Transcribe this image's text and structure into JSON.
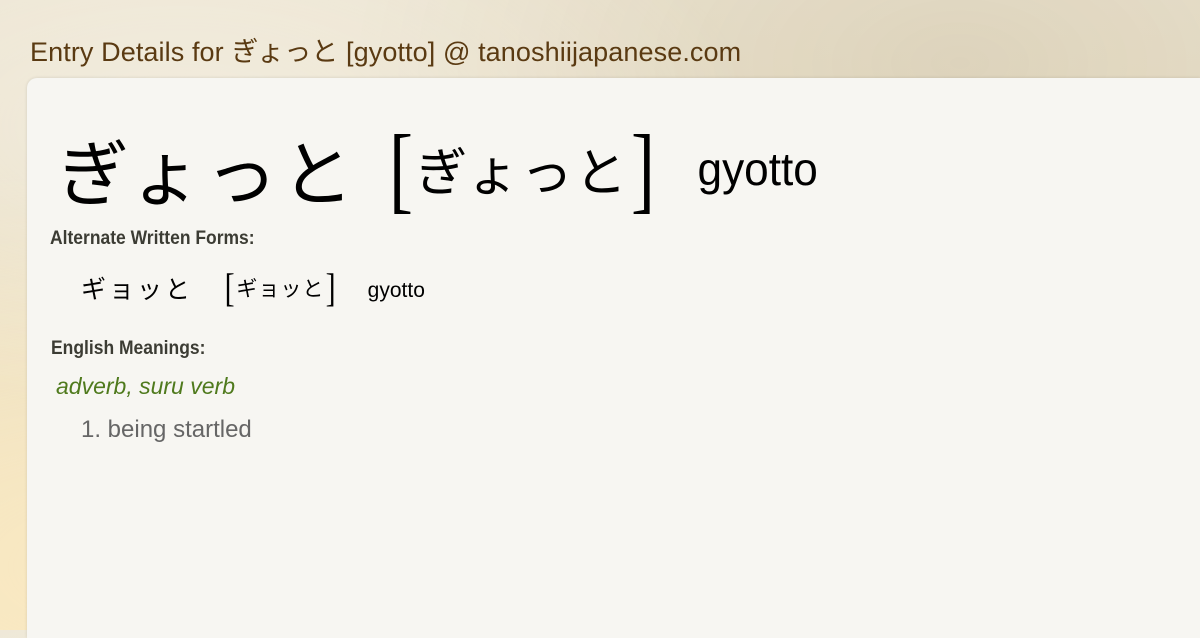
{
  "page": {
    "title": "Entry Details for ぎょっと [gyotto] @ tanoshiijapanese.com"
  },
  "entry": {
    "kana": "ぎょっと",
    "reading_kana": "ぎょっと",
    "romaji": "gyotto",
    "bracket_open": "[",
    "bracket_close": "]"
  },
  "alternate": {
    "label": "Alternate Written Forms:",
    "forms": [
      {
        "kana": "ギョッと",
        "reading_kana": "ギョッと",
        "romaji": "gyotto"
      }
    ]
  },
  "english": {
    "label": "English Meanings:",
    "part_of_speech": "adverb, suru verb",
    "meanings": [
      "1. being startled"
    ]
  },
  "colors": {
    "title": "#5a3a12",
    "part_of_speech": "#4f7a1d",
    "meaning_text": "#666666",
    "card_background": "#f7f6f2"
  }
}
